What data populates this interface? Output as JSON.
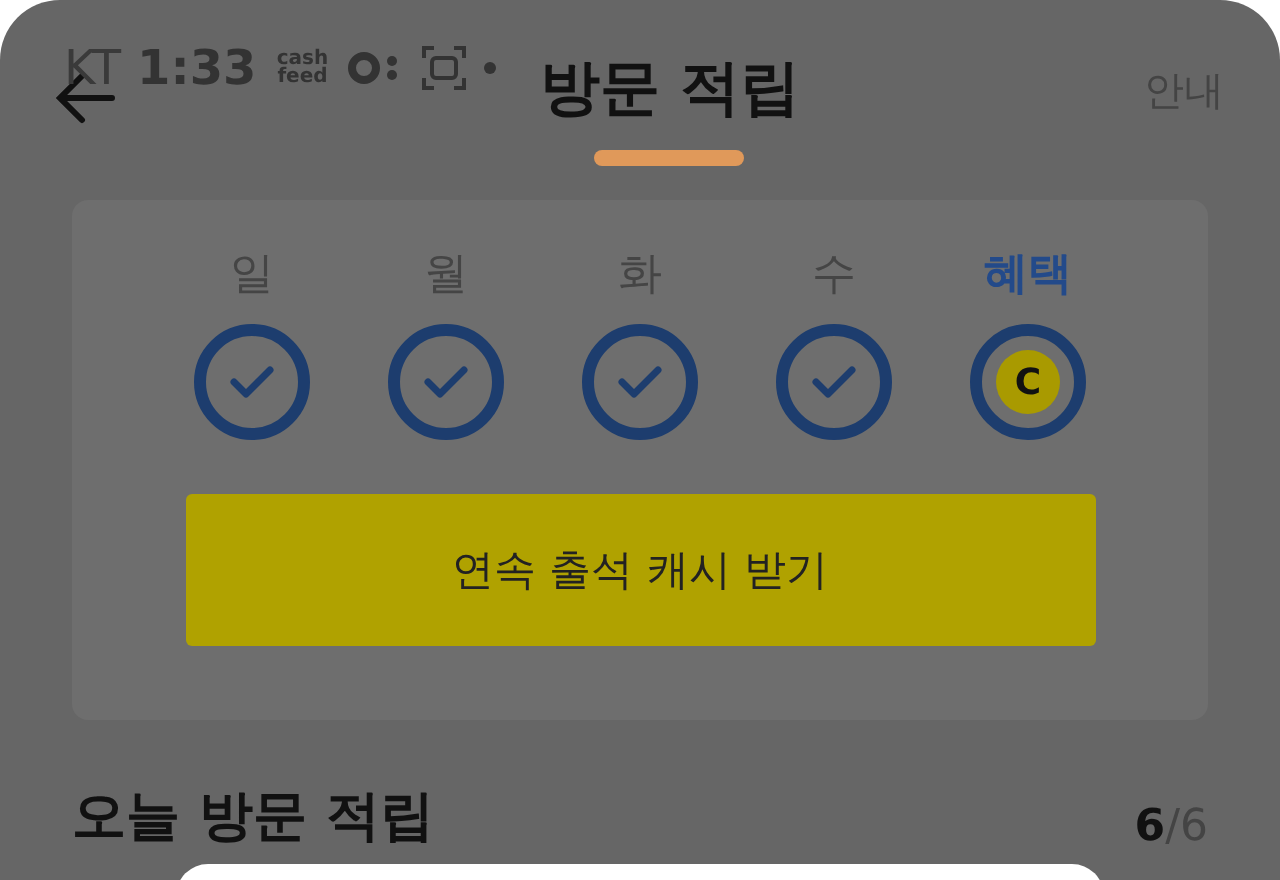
{
  "status_bar": {
    "carrier": "KT",
    "time": "1:33",
    "app_badge": "cash feed"
  },
  "header": {
    "title": "방문 적립",
    "action": "안내"
  },
  "days": [
    {
      "label": "일",
      "kind": "check",
      "selected": false
    },
    {
      "label": "월",
      "kind": "check",
      "selected": false
    },
    {
      "label": "화",
      "kind": "check",
      "selected": false
    },
    {
      "label": "수",
      "kind": "check",
      "selected": false
    },
    {
      "label": "혜택",
      "kind": "coin",
      "coin": "C",
      "selected": true
    }
  ],
  "claim_button": "연속 출석 캐시 받기",
  "section": {
    "title": "오늘 방문 적립",
    "count": "**6**/6"
  }
}
